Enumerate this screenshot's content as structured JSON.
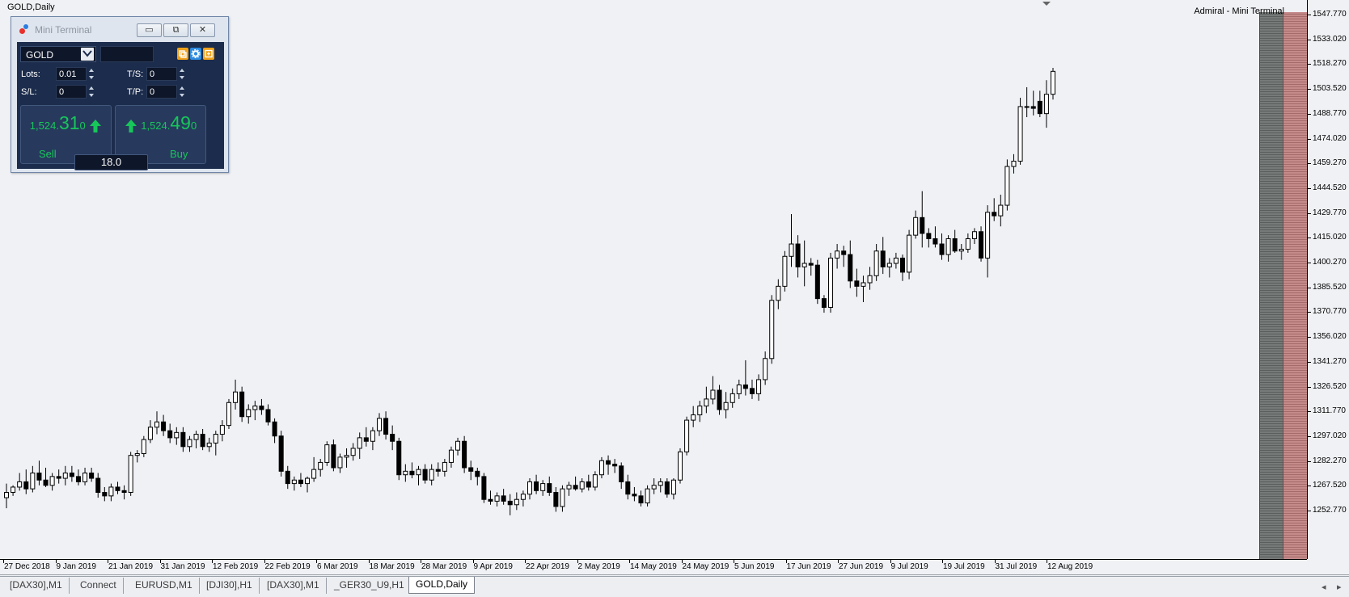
{
  "chart": {
    "title": "GOLD,Daily",
    "broker_label": "Admiral - Mini Terminal",
    "price_labels": [
      "1547.770",
      "1533.020",
      "1518.270",
      "1503.520",
      "1488.770",
      "1474.020",
      "1459.270",
      "1444.520",
      "1429.770",
      "1415.020",
      "1400.270",
      "1385.520",
      "1370.770",
      "1356.020",
      "1341.270",
      "1326.520",
      "1311.770",
      "1297.020",
      "1282.270",
      "1267.520",
      "1252.770"
    ],
    "date_labels": [
      "27 Dec 2018",
      "9 Jan 2019",
      "21 Jan 2019",
      "31 Jan 2019",
      "12 Feb 2019",
      "22 Feb 2019",
      "6 Mar 2019",
      "18 Mar 2019",
      "28 Mar 2019",
      "9 Apr 2019",
      "22 Apr 2019",
      "2 May 2019",
      "14 May 2019",
      "24 May 2019",
      "5 Jun 2019",
      "17 Jun 2019",
      "27 Jun 2019",
      "9 Jul 2019",
      "19 Jul 2019",
      "31 Jul 2019",
      "12 Aug 2019"
    ],
    "colors": {
      "background": "#eff1f4",
      "bull_body": "#ffffff",
      "bear_body": "#000000",
      "wick": "#000000",
      "dark_panel": "#6a6f6d",
      "red_panel": "#b67a7a"
    }
  },
  "chart_data": {
    "type": "candlestick",
    "symbol": "GOLD",
    "timeframe": "Daily",
    "ylim": [
      1245,
      1555
    ],
    "x_range": [
      "27 Dec 2018",
      "12 Aug 2019"
    ],
    "candles": [
      {
        "o": 1278,
        "h": 1286,
        "l": 1272,
        "c": 1281
      },
      {
        "o": 1281,
        "h": 1285,
        "l": 1279,
        "c": 1284
      },
      {
        "o": 1284,
        "h": 1292,
        "l": 1282,
        "c": 1287
      },
      {
        "o": 1287,
        "h": 1294,
        "l": 1280,
        "c": 1283
      },
      {
        "o": 1283,
        "h": 1296,
        "l": 1281,
        "c": 1292
      },
      {
        "o": 1292,
        "h": 1299,
        "l": 1285,
        "c": 1288
      },
      {
        "o": 1288,
        "h": 1295,
        "l": 1284,
        "c": 1285
      },
      {
        "o": 1285,
        "h": 1292,
        "l": 1282,
        "c": 1290
      },
      {
        "o": 1290,
        "h": 1294,
        "l": 1286,
        "c": 1289
      },
      {
        "o": 1289,
        "h": 1296,
        "l": 1285,
        "c": 1292
      },
      {
        "o": 1292,
        "h": 1296,
        "l": 1287,
        "c": 1290
      },
      {
        "o": 1290,
        "h": 1294,
        "l": 1285,
        "c": 1287
      },
      {
        "o": 1287,
        "h": 1295,
        "l": 1285,
        "c": 1292
      },
      {
        "o": 1292,
        "h": 1295,
        "l": 1287,
        "c": 1289
      },
      {
        "o": 1289,
        "h": 1292,
        "l": 1278,
        "c": 1281
      },
      {
        "o": 1281,
        "h": 1284,
        "l": 1276,
        "c": 1279
      },
      {
        "o": 1279,
        "h": 1286,
        "l": 1276,
        "c": 1284
      },
      {
        "o": 1284,
        "h": 1287,
        "l": 1280,
        "c": 1282
      },
      {
        "o": 1282,
        "h": 1285,
        "l": 1277,
        "c": 1281
      },
      {
        "o": 1281,
        "h": 1304,
        "l": 1279,
        "c": 1302
      },
      {
        "o": 1302,
        "h": 1305,
        "l": 1298,
        "c": 1303
      },
      {
        "o": 1303,
        "h": 1313,
        "l": 1301,
        "c": 1311
      },
      {
        "o": 1311,
        "h": 1322,
        "l": 1309,
        "c": 1318
      },
      {
        "o": 1318,
        "h": 1327,
        "l": 1314,
        "c": 1321
      },
      {
        "o": 1321,
        "h": 1325,
        "l": 1313,
        "c": 1316
      },
      {
        "o": 1316,
        "h": 1320,
        "l": 1309,
        "c": 1312
      },
      {
        "o": 1312,
        "h": 1318,
        "l": 1308,
        "c": 1315
      },
      {
        "o": 1315,
        "h": 1318,
        "l": 1304,
        "c": 1307
      },
      {
        "o": 1307,
        "h": 1313,
        "l": 1304,
        "c": 1311
      },
      {
        "o": 1311,
        "h": 1316,
        "l": 1306,
        "c": 1314
      },
      {
        "o": 1314,
        "h": 1317,
        "l": 1305,
        "c": 1307
      },
      {
        "o": 1307,
        "h": 1312,
        "l": 1304,
        "c": 1309
      },
      {
        "o": 1309,
        "h": 1316,
        "l": 1302,
        "c": 1314
      },
      {
        "o": 1314,
        "h": 1322,
        "l": 1310,
        "c": 1319
      },
      {
        "o": 1319,
        "h": 1334,
        "l": 1317,
        "c": 1332
      },
      {
        "o": 1332,
        "h": 1345,
        "l": 1328,
        "c": 1338
      },
      {
        "o": 1338,
        "h": 1341,
        "l": 1321,
        "c": 1324
      },
      {
        "o": 1324,
        "h": 1331,
        "l": 1320,
        "c": 1328
      },
      {
        "o": 1328,
        "h": 1333,
        "l": 1322,
        "c": 1330
      },
      {
        "o": 1330,
        "h": 1334,
        "l": 1325,
        "c": 1328
      },
      {
        "o": 1328,
        "h": 1331,
        "l": 1319,
        "c": 1321
      },
      {
        "o": 1321,
        "h": 1323,
        "l": 1309,
        "c": 1313
      },
      {
        "o": 1313,
        "h": 1316,
        "l": 1290,
        "c": 1293
      },
      {
        "o": 1293,
        "h": 1296,
        "l": 1283,
        "c": 1286
      },
      {
        "o": 1286,
        "h": 1290,
        "l": 1282,
        "c": 1288
      },
      {
        "o": 1288,
        "h": 1292,
        "l": 1284,
        "c": 1286
      },
      {
        "o": 1286,
        "h": 1290,
        "l": 1281,
        "c": 1289
      },
      {
        "o": 1289,
        "h": 1301,
        "l": 1287,
        "c": 1294
      },
      {
        "o": 1294,
        "h": 1300,
        "l": 1290,
        "c": 1298
      },
      {
        "o": 1298,
        "h": 1310,
        "l": 1296,
        "c": 1308
      },
      {
        "o": 1308,
        "h": 1311,
        "l": 1293,
        "c": 1295
      },
      {
        "o": 1295,
        "h": 1303,
        "l": 1292,
        "c": 1301
      },
      {
        "o": 1301,
        "h": 1306,
        "l": 1295,
        "c": 1302
      },
      {
        "o": 1302,
        "h": 1309,
        "l": 1299,
        "c": 1306
      },
      {
        "o": 1306,
        "h": 1315,
        "l": 1300,
        "c": 1312
      },
      {
        "o": 1312,
        "h": 1318,
        "l": 1307,
        "c": 1310
      },
      {
        "o": 1310,
        "h": 1318,
        "l": 1305,
        "c": 1316
      },
      {
        "o": 1316,
        "h": 1326,
        "l": 1313,
        "c": 1323
      },
      {
        "o": 1323,
        "h": 1327,
        "l": 1311,
        "c": 1314
      },
      {
        "o": 1314,
        "h": 1319,
        "l": 1305,
        "c": 1310
      },
      {
        "o": 1310,
        "h": 1312,
        "l": 1288,
        "c": 1291
      },
      {
        "o": 1291,
        "h": 1297,
        "l": 1287,
        "c": 1293
      },
      {
        "o": 1293,
        "h": 1298,
        "l": 1289,
        "c": 1291
      },
      {
        "o": 1291,
        "h": 1296,
        "l": 1285,
        "c": 1294
      },
      {
        "o": 1294,
        "h": 1297,
        "l": 1286,
        "c": 1288
      },
      {
        "o": 1288,
        "h": 1297,
        "l": 1285,
        "c": 1294
      },
      {
        "o": 1294,
        "h": 1298,
        "l": 1290,
        "c": 1293
      },
      {
        "o": 1293,
        "h": 1300,
        "l": 1290,
        "c": 1298
      },
      {
        "o": 1298,
        "h": 1307,
        "l": 1295,
        "c": 1305
      },
      {
        "o": 1305,
        "h": 1312,
        "l": 1302,
        "c": 1310
      },
      {
        "o": 1310,
        "h": 1313,
        "l": 1292,
        "c": 1295
      },
      {
        "o": 1295,
        "h": 1299,
        "l": 1288,
        "c": 1293
      },
      {
        "o": 1293,
        "h": 1295,
        "l": 1285,
        "c": 1290
      },
      {
        "o": 1290,
        "h": 1292,
        "l": 1275,
        "c": 1277
      },
      {
        "o": 1277,
        "h": 1282,
        "l": 1274,
        "c": 1276
      },
      {
        "o": 1276,
        "h": 1281,
        "l": 1273,
        "c": 1279
      },
      {
        "o": 1279,
        "h": 1283,
        "l": 1274,
        "c": 1276
      },
      {
        "o": 1276,
        "h": 1280,
        "l": 1268,
        "c": 1274
      },
      {
        "o": 1274,
        "h": 1281,
        "l": 1271,
        "c": 1277
      },
      {
        "o": 1277,
        "h": 1282,
        "l": 1273,
        "c": 1280
      },
      {
        "o": 1280,
        "h": 1289,
        "l": 1277,
        "c": 1287
      },
      {
        "o": 1287,
        "h": 1291,
        "l": 1280,
        "c": 1282
      },
      {
        "o": 1282,
        "h": 1288,
        "l": 1279,
        "c": 1286
      },
      {
        "o": 1286,
        "h": 1290,
        "l": 1279,
        "c": 1281
      },
      {
        "o": 1281,
        "h": 1284,
        "l": 1270,
        "c": 1273
      },
      {
        "o": 1273,
        "h": 1285,
        "l": 1270,
        "c": 1283
      },
      {
        "o": 1283,
        "h": 1287,
        "l": 1279,
        "c": 1285
      },
      {
        "o": 1285,
        "h": 1290,
        "l": 1282,
        "c": 1283
      },
      {
        "o": 1283,
        "h": 1289,
        "l": 1281,
        "c": 1287
      },
      {
        "o": 1287,
        "h": 1291,
        "l": 1282,
        "c": 1284
      },
      {
        "o": 1284,
        "h": 1293,
        "l": 1282,
        "c": 1291
      },
      {
        "o": 1291,
        "h": 1301,
        "l": 1289,
        "c": 1299
      },
      {
        "o": 1299,
        "h": 1302,
        "l": 1291,
        "c": 1297
      },
      {
        "o": 1297,
        "h": 1300,
        "l": 1292,
        "c": 1296
      },
      {
        "o": 1296,
        "h": 1298,
        "l": 1283,
        "c": 1287
      },
      {
        "o": 1287,
        "h": 1291,
        "l": 1277,
        "c": 1280
      },
      {
        "o": 1280,
        "h": 1284,
        "l": 1276,
        "c": 1279
      },
      {
        "o": 1279,
        "h": 1282,
        "l": 1273,
        "c": 1275
      },
      {
        "o": 1275,
        "h": 1285,
        "l": 1273,
        "c": 1283
      },
      {
        "o": 1283,
        "h": 1289,
        "l": 1280,
        "c": 1285
      },
      {
        "o": 1285,
        "h": 1289,
        "l": 1281,
        "c": 1287
      },
      {
        "o": 1287,
        "h": 1289,
        "l": 1278,
        "c": 1280
      },
      {
        "o": 1280,
        "h": 1289,
        "l": 1277,
        "c": 1288
      },
      {
        "o": 1288,
        "h": 1306,
        "l": 1286,
        "c": 1304
      },
      {
        "o": 1304,
        "h": 1324,
        "l": 1302,
        "c": 1322
      },
      {
        "o": 1322,
        "h": 1330,
        "l": 1318,
        "c": 1325
      },
      {
        "o": 1325,
        "h": 1333,
        "l": 1321,
        "c": 1330
      },
      {
        "o": 1330,
        "h": 1341,
        "l": 1326,
        "c": 1334
      },
      {
        "o": 1334,
        "h": 1347,
        "l": 1331,
        "c": 1339
      },
      {
        "o": 1339,
        "h": 1342,
        "l": 1325,
        "c": 1328
      },
      {
        "o": 1328,
        "h": 1338,
        "l": 1323,
        "c": 1332
      },
      {
        "o": 1332,
        "h": 1340,
        "l": 1329,
        "c": 1337
      },
      {
        "o": 1337,
        "h": 1345,
        "l": 1334,
        "c": 1342
      },
      {
        "o": 1342,
        "h": 1356,
        "l": 1336,
        "c": 1340
      },
      {
        "o": 1340,
        "h": 1345,
        "l": 1334,
        "c": 1337
      },
      {
        "o": 1337,
        "h": 1348,
        "l": 1333,
        "c": 1345
      },
      {
        "o": 1345,
        "h": 1361,
        "l": 1342,
        "c": 1357
      },
      {
        "o": 1357,
        "h": 1393,
        "l": 1354,
        "c": 1390
      },
      {
        "o": 1390,
        "h": 1402,
        "l": 1385,
        "c": 1398
      },
      {
        "o": 1398,
        "h": 1418,
        "l": 1395,
        "c": 1415
      },
      {
        "o": 1415,
        "h": 1439,
        "l": 1409,
        "c": 1422
      },
      {
        "o": 1422,
        "h": 1427,
        "l": 1403,
        "c": 1409
      },
      {
        "o": 1409,
        "h": 1424,
        "l": 1398,
        "c": 1411
      },
      {
        "o": 1411,
        "h": 1414,
        "l": 1404,
        "c": 1410
      },
      {
        "o": 1410,
        "h": 1413,
        "l": 1388,
        "c": 1391
      },
      {
        "o": 1391,
        "h": 1393,
        "l": 1383,
        "c": 1386
      },
      {
        "o": 1386,
        "h": 1417,
        "l": 1383,
        "c": 1414
      },
      {
        "o": 1414,
        "h": 1422,
        "l": 1408,
        "c": 1418
      },
      {
        "o": 1418,
        "h": 1421,
        "l": 1409,
        "c": 1416
      },
      {
        "o": 1416,
        "h": 1424,
        "l": 1397,
        "c": 1401
      },
      {
        "o": 1401,
        "h": 1408,
        "l": 1392,
        "c": 1398
      },
      {
        "o": 1398,
        "h": 1404,
        "l": 1389,
        "c": 1400
      },
      {
        "o": 1400,
        "h": 1409,
        "l": 1396,
        "c": 1404
      },
      {
        "o": 1404,
        "h": 1422,
        "l": 1401,
        "c": 1418
      },
      {
        "o": 1418,
        "h": 1426,
        "l": 1405,
        "c": 1409
      },
      {
        "o": 1409,
        "h": 1414,
        "l": 1403,
        "c": 1411
      },
      {
        "o": 1411,
        "h": 1417,
        "l": 1408,
        "c": 1414
      },
      {
        "o": 1414,
        "h": 1416,
        "l": 1401,
        "c": 1406
      },
      {
        "o": 1406,
        "h": 1430,
        "l": 1402,
        "c": 1427
      },
      {
        "o": 1427,
        "h": 1441,
        "l": 1425,
        "c": 1437
      },
      {
        "o": 1437,
        "h": 1452,
        "l": 1420,
        "c": 1428
      },
      {
        "o": 1428,
        "h": 1431,
        "l": 1420,
        "c": 1425
      },
      {
        "o": 1425,
        "h": 1432,
        "l": 1420,
        "c": 1422
      },
      {
        "o": 1422,
        "h": 1428,
        "l": 1413,
        "c": 1416
      },
      {
        "o": 1416,
        "h": 1427,
        "l": 1412,
        "c": 1425
      },
      {
        "o": 1425,
        "h": 1430,
        "l": 1417,
        "c": 1418
      },
      {
        "o": 1418,
        "h": 1422,
        "l": 1413,
        "c": 1419
      },
      {
        "o": 1419,
        "h": 1428,
        "l": 1417,
        "c": 1425
      },
      {
        "o": 1425,
        "h": 1431,
        "l": 1422,
        "c": 1429
      },
      {
        "o": 1429,
        "h": 1432,
        "l": 1412,
        "c": 1414
      },
      {
        "o": 1414,
        "h": 1444,
        "l": 1403,
        "c": 1440
      },
      {
        "o": 1440,
        "h": 1448,
        "l": 1435,
        "c": 1438
      },
      {
        "o": 1438,
        "h": 1450,
        "l": 1432,
        "c": 1444
      },
      {
        "o": 1444,
        "h": 1470,
        "l": 1441,
        "c": 1466
      },
      {
        "o": 1466,
        "h": 1473,
        "l": 1462,
        "c": 1469
      },
      {
        "o": 1469,
        "h": 1505,
        "l": 1467,
        "c": 1500
      },
      {
        "o": 1500,
        "h": 1511,
        "l": 1494,
        "c": 1500
      },
      {
        "o": 1500,
        "h": 1509,
        "l": 1495,
        "c": 1499
      },
      {
        "o": 1503,
        "h": 1509,
        "l": 1494,
        "c": 1496
      },
      {
        "o": 1496,
        "h": 1515,
        "l": 1488,
        "c": 1507
      },
      {
        "o": 1507,
        "h": 1522,
        "l": 1504,
        "c": 1520
      }
    ]
  },
  "mini_terminal": {
    "title": "Mini Terminal",
    "window_buttons": {
      "minimize": "▭",
      "restore": "⧉",
      "close": "✕"
    },
    "symbol": "GOLD",
    "lots_label": "Lots:",
    "lots_value": "0.01",
    "sl_label": "S/L:",
    "sl_value": "0",
    "ts_label": "T/S:",
    "ts_value": "0",
    "tp_label": "T/P:",
    "tp_value": "0",
    "sell_price_prefix": "1,524.",
    "sell_price_big": "31",
    "sell_price_suffix": "0",
    "buy_price_prefix": "1,524.",
    "buy_price_big": "49",
    "buy_price_suffix": "0",
    "sell_label": "Sell",
    "buy_label": "Buy",
    "spread": "18.0",
    "colors": {
      "price_green": "#17c65a",
      "body_bg": "#1c2c4c",
      "tool_orange": "#f0a21a",
      "tool_blue": "#2d8be0"
    }
  },
  "tabs": [
    {
      "label": "[DAX30],M1",
      "active": false
    },
    {
      "label": "Connect",
      "active": false
    },
    {
      "label": "EURUSD,M1",
      "active": false
    },
    {
      "label": "[DJI30],H1",
      "active": false
    },
    {
      "label": "[DAX30],M1",
      "active": false
    },
    {
      "label": "_GER30_U9,H1",
      "active": false
    },
    {
      "label": "GOLD,Daily",
      "active": true
    }
  ],
  "tab_scroll": {
    "left": "◂",
    "right": "▸"
  }
}
